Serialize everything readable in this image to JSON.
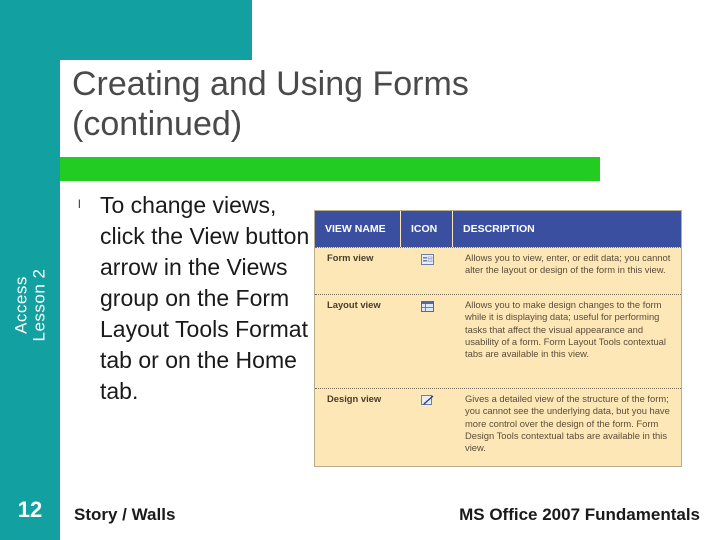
{
  "slide": {
    "title_line1": "Creating and Using Forms",
    "title_line2": "(continued)",
    "side_label_line1": "Access",
    "side_label_line2": "Lesson 2",
    "number": "12",
    "bullet_symbol": "l",
    "bullet_text": "To change views, click the View button arrow in the Views group on the Form Layout Tools Format tab or on the Home tab.",
    "footer_left": "Story / Walls",
    "footer_right": "MS Office 2007 Fundamentals"
  },
  "table": {
    "headers": [
      "VIEW NAME",
      "ICON",
      "DESCRIPTION"
    ],
    "rows": [
      {
        "name": "Form view",
        "icon": "form-view-icon",
        "description": "Allows you to view, enter, or edit data; you cannot alter the layout or design of the form in this view."
      },
      {
        "name": "Layout view",
        "icon": "layout-view-icon",
        "description": "Allows you to make design changes to the form while it is displaying data; useful for performing tasks that affect the visual appearance and usability of a form. Form Layout Tools contextual tabs are available in this view."
      },
      {
        "name": "Design view",
        "icon": "design-view-icon",
        "description": "Gives a detailed view of the structure of the form; you cannot see the underlying data, but you have more control over the design of the form. Form Design Tools contextual tabs are available in this view."
      }
    ]
  },
  "colors": {
    "teal": "#12a0a0",
    "green_bar": "#22cc22",
    "table_header": "#3a4fa0",
    "table_body": "#fde7b7"
  }
}
